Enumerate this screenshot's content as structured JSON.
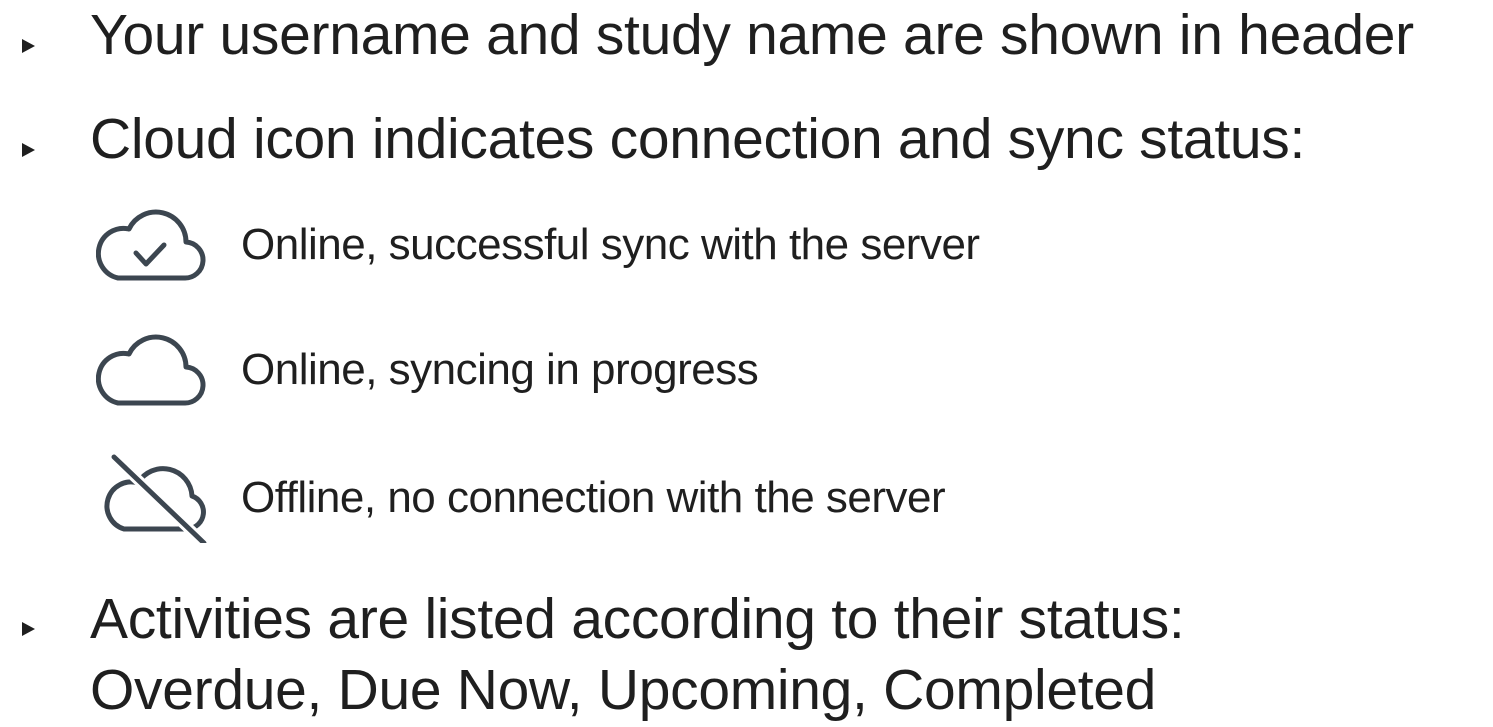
{
  "bullets": [
    {
      "text": "Your username and study name are shown in header"
    },
    {
      "text": "Cloud icon indicates connection and sync status:"
    },
    {
      "line1": "Activities are listed according to their status:",
      "line2": "Overdue, Due Now, Upcoming, Completed"
    }
  ],
  "statuses": [
    {
      "icon": "cloud-check-icon",
      "label": "Online, successful sync with the server"
    },
    {
      "icon": "cloud-icon",
      "label": "Online, syncing in progress"
    },
    {
      "icon": "cloud-off-icon",
      "label": "Offline, no connection with the server"
    }
  ],
  "colors": {
    "text": "#1f1f1f",
    "icon": "#3c4650"
  }
}
